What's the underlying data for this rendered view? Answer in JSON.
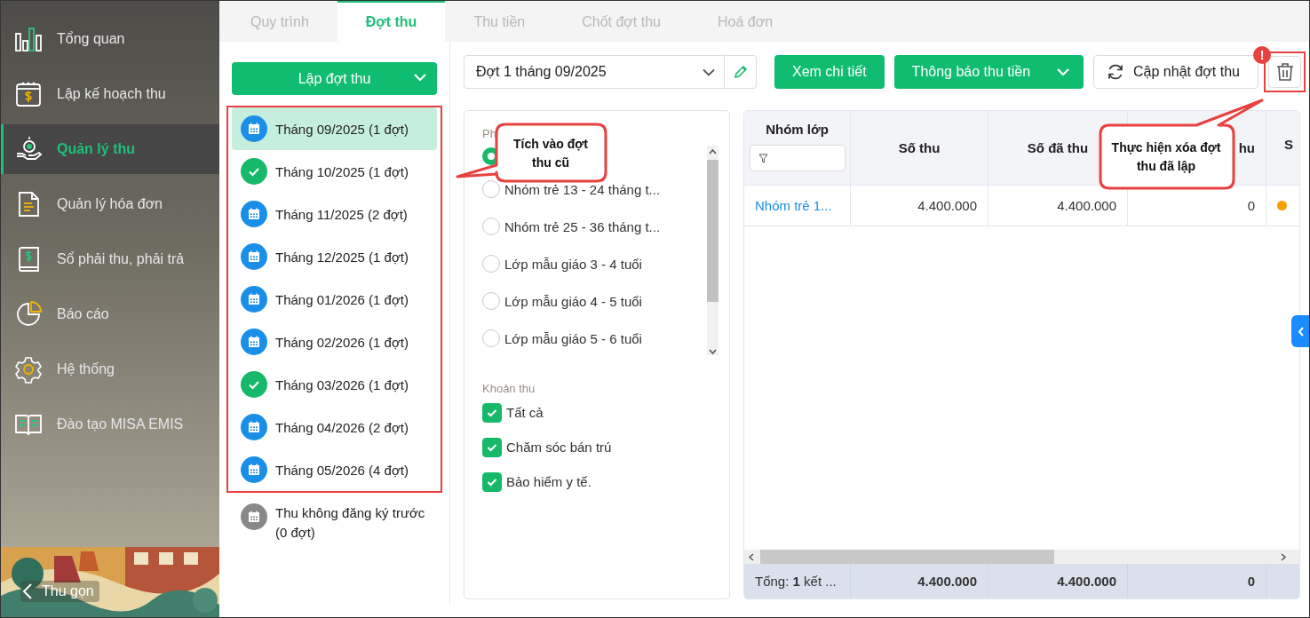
{
  "sidebar": {
    "items": [
      {
        "label": "Tổng quan",
        "selected": false
      },
      {
        "label": "Lập kế hoạch thu",
        "selected": false
      },
      {
        "label": "Quản lý thu",
        "selected": true
      },
      {
        "label": "Quản lý hóa đơn",
        "selected": false
      },
      {
        "label": "Sổ phải thu, phải trả",
        "selected": false
      },
      {
        "label": "Báo cáo",
        "selected": false
      },
      {
        "label": "Hệ thống",
        "selected": false
      },
      {
        "label": "Đào tạo MISA EMIS",
        "selected": false
      }
    ],
    "collapse": "Thu gọn"
  },
  "tabs": [
    {
      "label": "Quy trình",
      "selected": false
    },
    {
      "label": "Đợt thu",
      "selected": true
    },
    {
      "label": "Thu tiền",
      "selected": false
    },
    {
      "label": "Chốt đợt thu",
      "selected": false
    },
    {
      "label": "Hoá đơn",
      "selected": false
    }
  ],
  "period_panel": {
    "create_button": "Lập đợt thu",
    "periods": [
      {
        "label": "Tháng 09/2025 (1 đợt)",
        "kind": "pending",
        "selected": true
      },
      {
        "label": "Tháng 10/2025 (1 đợt)",
        "kind": "done",
        "selected": false
      },
      {
        "label": "Tháng 11/2025 (2 đợt)",
        "kind": "pending",
        "selected": false
      },
      {
        "label": "Tháng 12/2025 (1 đợt)",
        "kind": "pending",
        "selected": false
      },
      {
        "label": "Tháng 01/2026 (1 đợt)",
        "kind": "pending",
        "selected": false
      },
      {
        "label": "Tháng 02/2026 (1 đợt)",
        "kind": "pending",
        "selected": false
      },
      {
        "label": "Tháng 03/2026 (1 đợt)",
        "kind": "done",
        "selected": false
      },
      {
        "label": "Tháng 04/2026 (2 đợt)",
        "kind": "pending",
        "selected": false
      },
      {
        "label": "Tháng 05/2026 (4 đợt)",
        "kind": "pending",
        "selected": false
      }
    ],
    "other_period": {
      "label": "Thu không đăng ký trước (0 đợt)",
      "kind": "none",
      "selected": false
    }
  },
  "toolbar": {
    "period_select": "Đợt 1 tháng 09/2025",
    "buttons": [
      {
        "label": "Xem chi tiết",
        "kind": "primary"
      },
      {
        "label": "Thông báo thu tiền",
        "kind": "split"
      },
      {
        "label": "Cập nhật đợt thu",
        "kind": "refresh"
      }
    ],
    "delete_badge": "!"
  },
  "filters": {
    "group_label": "Ph",
    "groups": [
      {
        "selected": true
      },
      {
        "label": "Nhóm trẻ 13 - 24 tháng t...",
        "selected": false
      },
      {
        "label": "Nhóm trẻ 25 - 36 tháng t...",
        "selected": false
      },
      {
        "label": "Lớp mẫu giáo 3 - 4 tuổi",
        "selected": false
      },
      {
        "label": "Lớp mẫu giáo 4 - 5 tuổi",
        "selected": false
      },
      {
        "label": "Lớp mẫu giáo 5 - 6 tuổi",
        "selected": false
      }
    ],
    "fees_label": "Khoản thu",
    "fees": [
      {
        "label": "Tất cả",
        "checked": true
      },
      {
        "label": "Chăm sóc bán trú",
        "checked": true
      },
      {
        "label": "Bảo hiểm y tế.",
        "checked": true
      }
    ]
  },
  "table": {
    "columns": [
      "Nhóm lớp",
      "Số thu",
      "Số đã thu",
      "hu",
      "S"
    ],
    "rows": [
      {
        "cells": [
          "Nhóm trẻ 1...",
          "4.400.000",
          "4.400.000",
          "0"
        ],
        "color": "#f5a000"
      }
    ],
    "footer": {
      "label": "Tổng: **1** kết ...",
      "cells": [
        "4.400.000",
        "4.400.000",
        "0"
      ]
    }
  },
  "callouts": [
    {
      "text": "Tích vào đợt thu cũ"
    },
    {
      "text": "Thực hiện xóa đợt thu đã lập"
    }
  ]
}
